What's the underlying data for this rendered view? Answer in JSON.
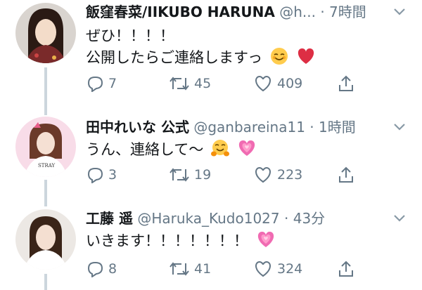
{
  "tweets": [
    {
      "name": "飯窪春菜/IIKUBO HARUNA",
      "handle": "@h...",
      "time": "· 7時間",
      "text": "ぜひ！！！！\n公開したらご連絡しますっ",
      "line1": "ぜひ！！！！",
      "line2": "公開したらご連絡しますっ",
      "emojis": [
        "smiling-face-emoji",
        "red-heart-emoji"
      ],
      "replies": "7",
      "retweets": "45",
      "likes": "409"
    },
    {
      "name": "田中れいな 公式",
      "handle": "@ganbareina11",
      "time": "· 1時間",
      "text": "うん、連絡して〜",
      "emojis": [
        "hugging-face-emoji",
        "growing-heart-emoji"
      ],
      "replies": "3",
      "retweets": "19",
      "likes": "223"
    },
    {
      "name": "工藤 遥",
      "handle": "@Haruka_Kudo1027",
      "time": "· 43分",
      "text": "いきます！！！！！！！",
      "emojis": [
        "growing-heart-emoji"
      ],
      "replies": "8",
      "retweets": "41",
      "likes": "324"
    }
  ],
  "colors": {
    "text": "#14171a",
    "meta": "#657786",
    "thread_line": "#ccd6dd",
    "heart_red": "#e0245e",
    "heart_pink": "#f06bb2"
  }
}
